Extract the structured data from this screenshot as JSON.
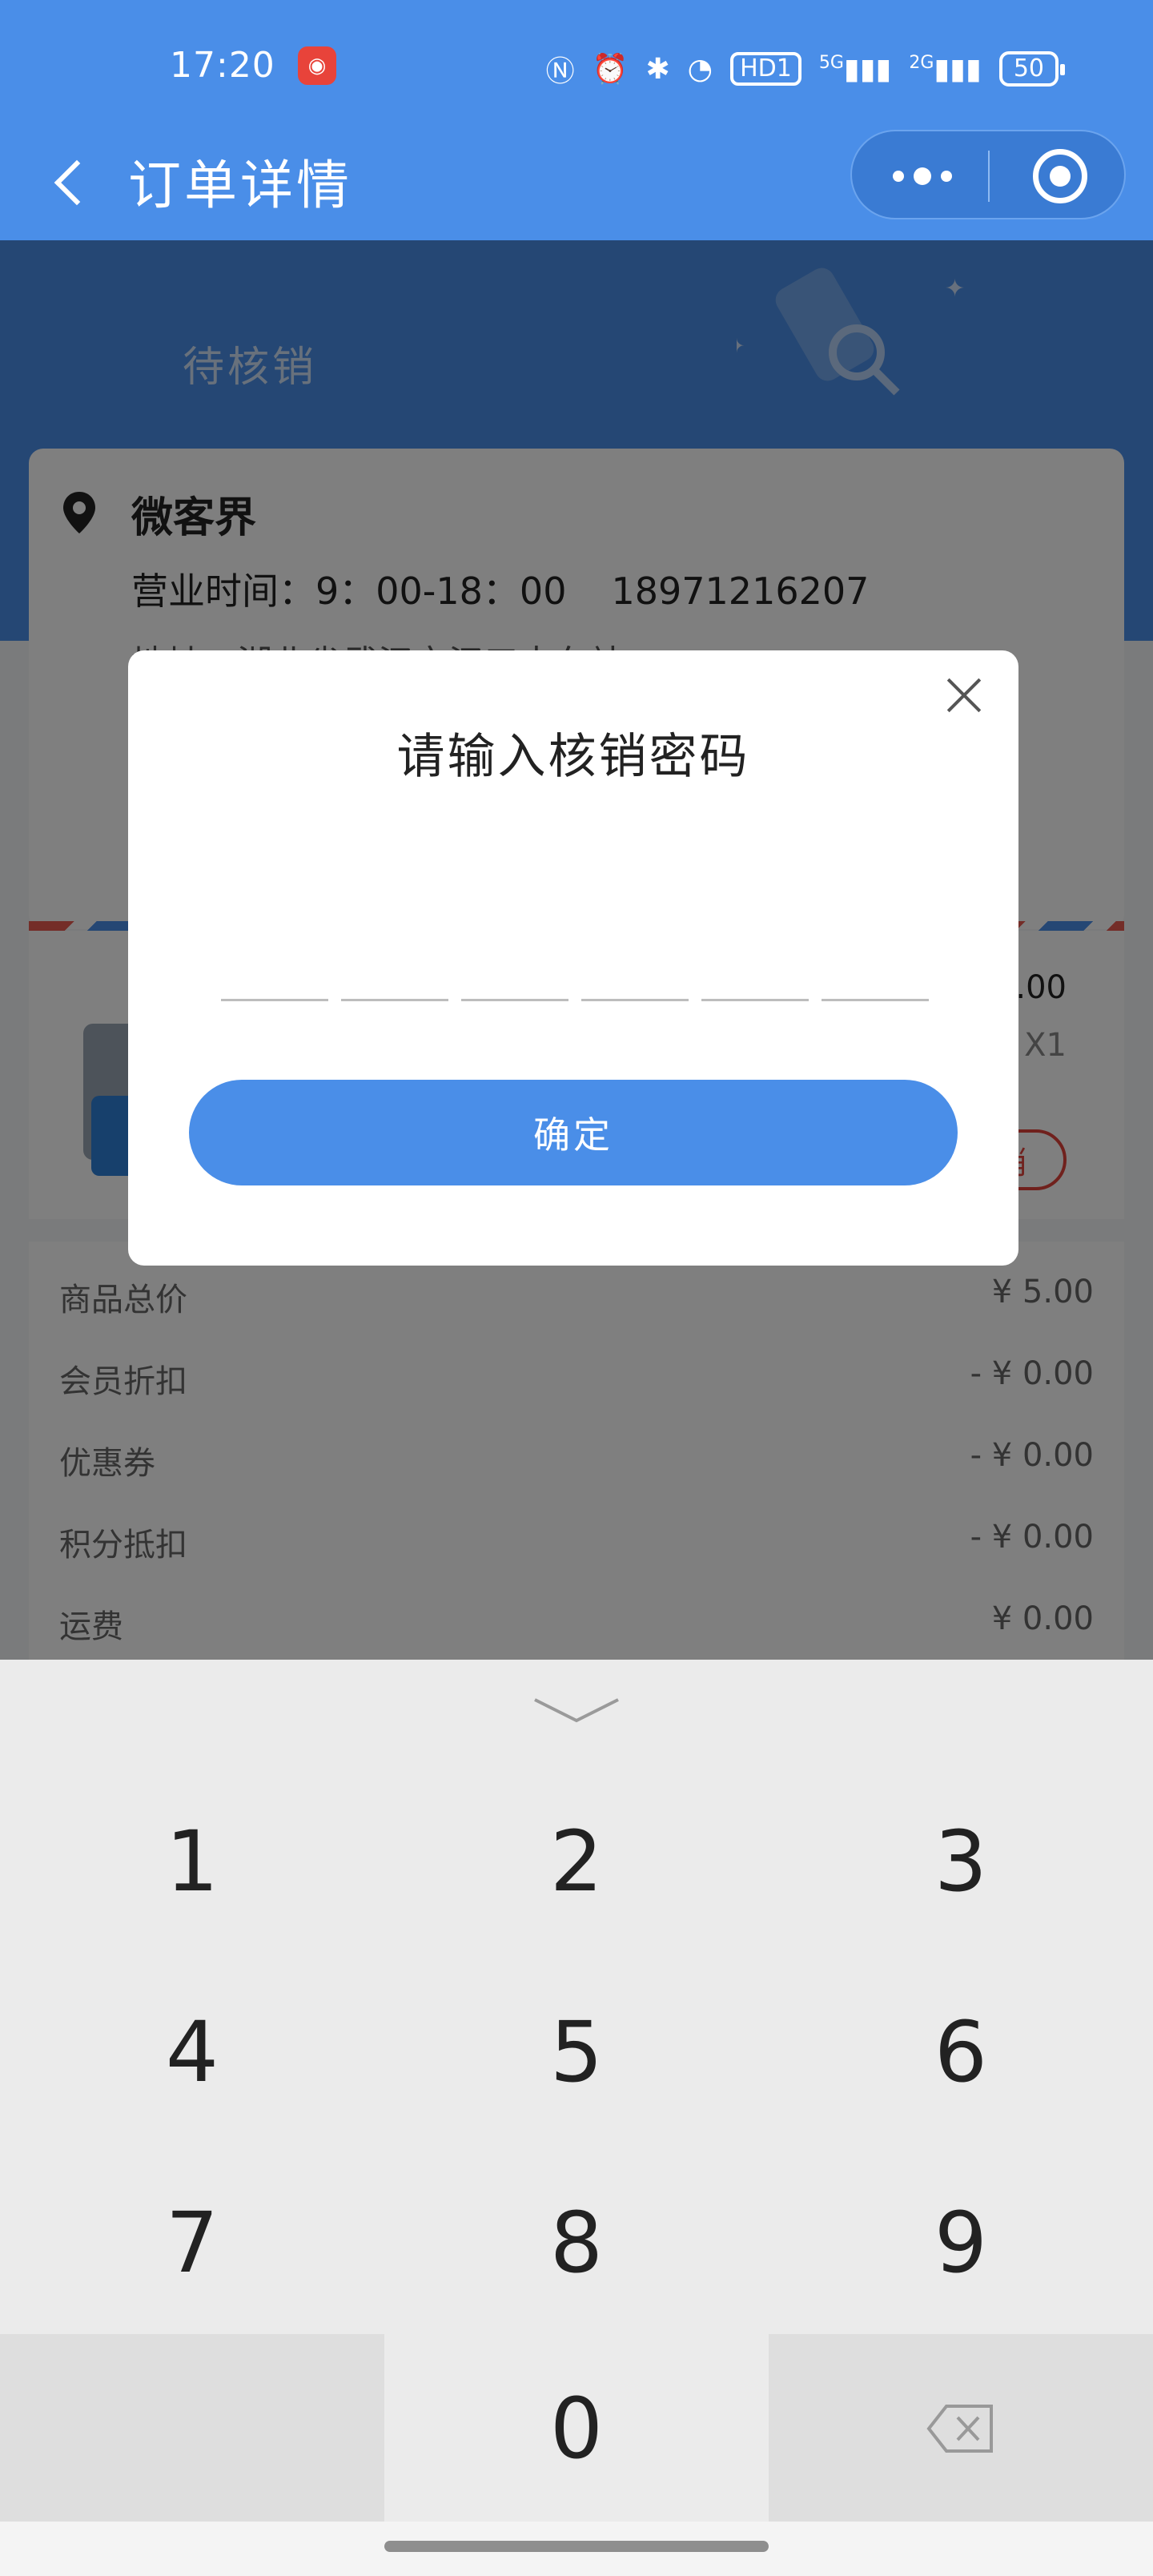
{
  "status_bar": {
    "time": "17:20",
    "network_5g": "5G",
    "network_2g": "2G",
    "hd_badge": "HD1",
    "battery": "50"
  },
  "nav": {
    "title": "订单详情",
    "more_icon": "more-icon",
    "target_icon": "target-icon"
  },
  "order": {
    "status": "待核销",
    "store_name": "微客界",
    "hours": "营业时间：9：00-18：00",
    "phone": "18971216207",
    "address": "地址：湖北省武汉市汉口中车站"
  },
  "product": {
    "price": "5.00",
    "qty": "X1",
    "verify_label": "核销"
  },
  "summary": [
    {
      "label": "商品总价",
      "value": "¥ 5.00"
    },
    {
      "label": "会员折扣",
      "value": "- ¥ 0.00"
    },
    {
      "label": "优惠券",
      "value": "- ¥ 0.00"
    },
    {
      "label": "积分抵扣",
      "value": "- ¥ 0.00"
    },
    {
      "label": "运费",
      "value": "¥ 0.00"
    }
  ],
  "modal": {
    "title": "请输入核销密码",
    "slots": [
      "",
      "",
      "",
      "",
      "",
      ""
    ],
    "confirm_label": "确定"
  },
  "keypad": {
    "keys": [
      "1",
      "2",
      "3",
      "4",
      "5",
      "6",
      "7",
      "8",
      "9",
      "",
      "0",
      ""
    ]
  },
  "colors": {
    "primary": "#4a8ee8",
    "danger": "#e0433a"
  }
}
